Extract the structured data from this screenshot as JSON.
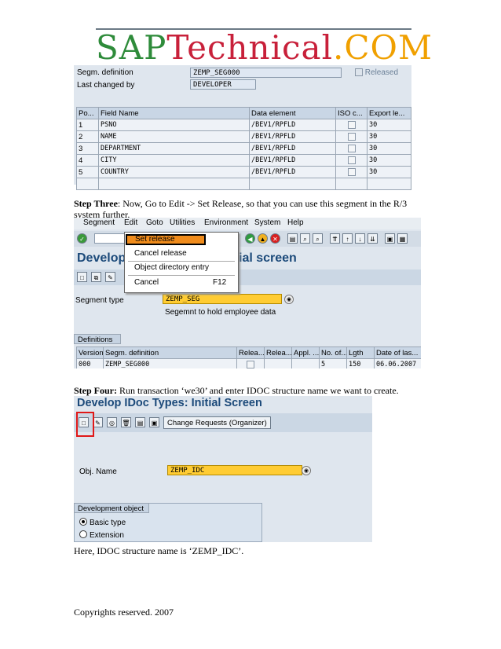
{
  "logo": {
    "part1": "SAP",
    "part2": "Technical",
    "part3": ".COM"
  },
  "shot1": {
    "segm_label": "Segm. definition",
    "segm_value": "ZEMP_SEG000",
    "released_label": "Released",
    "last_changed_label": "Last changed by",
    "last_changed_value": "DEVELOPER",
    "table": {
      "headers": [
        "Po...",
        "Field Name",
        "Data element",
        "ISO c...",
        "Export le..."
      ],
      "rows": [
        [
          "1",
          "PSNO",
          "/BEV1/RPFLD",
          "",
          "30"
        ],
        [
          "2",
          "NAME",
          "/BEV1/RPFLD",
          "",
          "30"
        ],
        [
          "3",
          "DEPARTMENT",
          "/BEV1/RPFLD",
          "",
          "30"
        ],
        [
          "4",
          "CITY",
          "/BEV1/RPFLD",
          "",
          "30"
        ],
        [
          "5",
          "COUNTRY",
          "/BEV1/RPFLD",
          "",
          "30"
        ]
      ]
    }
  },
  "step3": {
    "bold": "Step Three",
    "text": ": Now, Go to Edit -> Set Release, so that you can use this segment in the R/3 system further."
  },
  "shot2": {
    "menubar": [
      "Segment",
      "Edit",
      "Goto",
      "Utilities",
      "Environment",
      "System",
      "Help"
    ],
    "menu_items": {
      "set_release": "Set release",
      "cancel_release": "Cancel release",
      "object_directory": "Object directory entry",
      "cancel": "Cancel",
      "cancel_key": "F12"
    },
    "title_left": "Develop",
    "title_right": "ial screen",
    "segment_type_label": "Segment type",
    "segment_type_value": "ZEMP_SEG",
    "segment_desc": "Segemnt to hold employee data",
    "definitions_tab": "Definitions",
    "table": {
      "headers": [
        "Version",
        "Segm. definition",
        "Relea...",
        "Relea...",
        "Appl. ...",
        "No. of...",
        "Lgth",
        "Date of las..."
      ],
      "row": [
        "000",
        "ZEMP_SEG000",
        "",
        "",
        "",
        "5",
        "150",
        "06.06.2007"
      ]
    }
  },
  "step4": {
    "bold": "Step Four:",
    "text": " Run transaction ‘we30’ and enter IDOC structure name we want to create."
  },
  "shot3": {
    "title": "Develop IDoc Types: Initial Screen",
    "change_requests": "Change Requests (Organizer)",
    "obj_name_label": "Obj. Name",
    "obj_name_value": "ZEMP_IDC",
    "dev_object_tab": "Development object",
    "basic_type": "Basic type",
    "extension": "Extension"
  },
  "note": "Here, IDOC structure name is ‘ZEMP_IDC’.",
  "footer": "Copyrights reserved. 2007",
  "colors": {
    "sap_blue_title": "#1c4a7a",
    "highlight_orange": "#f08c1c",
    "input_yellow": "#ffcc33",
    "red_box": "#e01818"
  }
}
